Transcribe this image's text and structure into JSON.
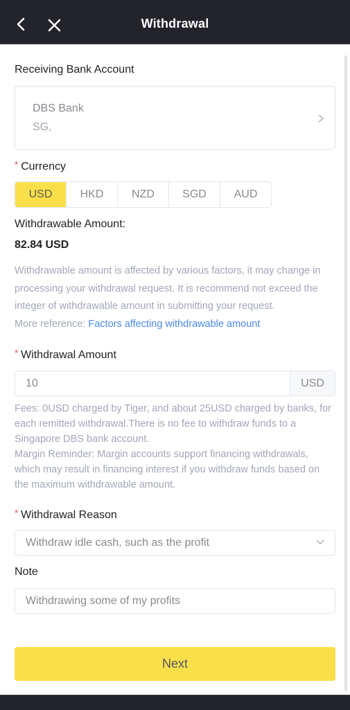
{
  "header": {
    "title": "Withdrawal",
    "back_icon": "chevron-left-icon",
    "close_icon": "close-icon"
  },
  "bank": {
    "label": "Receiving Bank Account",
    "name": "DBS Bank",
    "country": "SG,",
    "chevron_icon": "chevron-right-icon"
  },
  "currency": {
    "label": "Currency",
    "required_mark": "*",
    "options": [
      "USD",
      "HKD",
      "NZD",
      "SGD",
      "AUD"
    ],
    "selected": "USD",
    "active_color": "#f9e04b"
  },
  "withdrawable": {
    "label": "Withdrawable Amount:",
    "value": "82.84 USD",
    "hint_line": "Withdrawable amount is affected by various factors, it may change in processing your withdrawal request. It is recommend not exceed the integer of withdrawable amount in submitting your request.",
    "more_reference_prefix": "More reference:",
    "more_reference_link": "Factors affecting withdrawable amount",
    "link_color": "#4a8ae8"
  },
  "amount": {
    "label": "Withdrawal Amount",
    "required_mark": "*",
    "value": "10",
    "suffix": "USD",
    "fees_text": "Fees: 0USD charged by Tiger, and about 25USD charged by banks, for each remitted withdrawal.There is no fee to withdraw funds to a Singapore DBS bank account.",
    "margin_text": "Margin Reminder: Margin accounts support financing withdrawals, which may result in financing interest if you withdraw funds based on the maximum withdrawable amount."
  },
  "reason": {
    "label": "Withdrawal Reason",
    "required_mark": "*",
    "selected": "Withdraw idle cash, such as the profit",
    "chevron_icon": "chevron-down-icon"
  },
  "note": {
    "label": "Note",
    "value": "Withdrawing some of my profits"
  },
  "actions": {
    "next_label": "Next",
    "button_color": "#f9e04b"
  }
}
